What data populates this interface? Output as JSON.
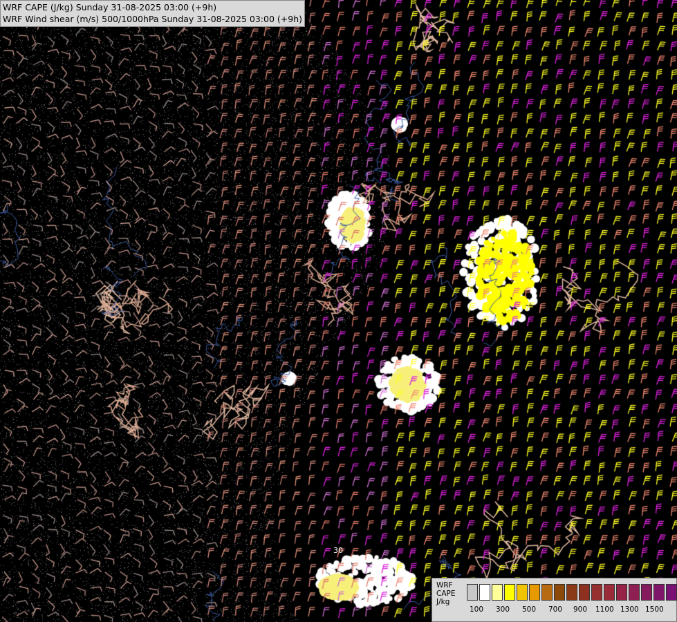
{
  "title": {
    "line1": "WRF CAPE (J/kg) Sunday 31-08-2025 03:00 (+9h)",
    "line2": "WRF Wind shear (m/s) 500/1000hPa Sunday 31-08-2025 03:00 (+9h)"
  },
  "legend": {
    "label_line1": "WRF",
    "label_line2": "CAPE",
    "label_line3": "J/kg",
    "colors": [
      "#c8c8c8",
      "#ffffff",
      "#ffff99",
      "#ffff00",
      "#f2c400",
      "#e69900",
      "#b86a10",
      "#8c4a0a",
      "#8a3a16",
      "#8e3020",
      "#963030",
      "#9a2c3a",
      "#962446",
      "#8e1f52",
      "#861a5e",
      "#80166a",
      "#7a1276",
      "#741082"
    ],
    "ticks": [
      "100",
      "300",
      "500",
      "700",
      "900",
      "1100",
      "1300",
      "1500"
    ]
  },
  "map_annotation": "30"
}
